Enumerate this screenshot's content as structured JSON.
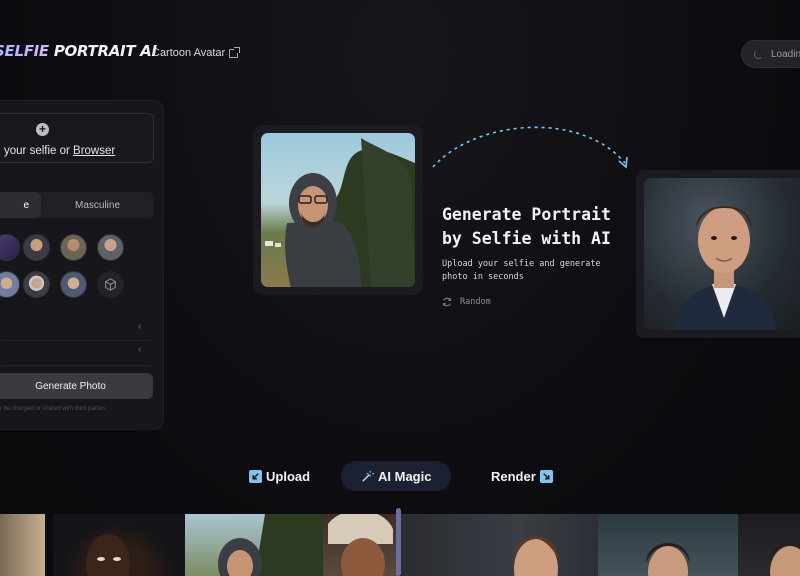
{
  "header": {
    "logo_part1": "SELFIE",
    "logo_part2": "PORTRAIT AI",
    "nav_link": "Cartoon Avatar",
    "loading_label": "Loadin"
  },
  "sidebar": {
    "upload_prefix": "your selfie or ",
    "upload_link": "Browser",
    "gender_options": [
      "e",
      "Masculine"
    ],
    "generate_button": "Generate Photo",
    "fine_print": "r be charged or shared with third parties"
  },
  "hero": {
    "title_line1": "Generate Portrait",
    "title_line2": "by Selfie with AI",
    "subtitle": "Upload your selfie and generate photo in seconds",
    "random_label": "Random"
  },
  "steps": [
    {
      "label": "Upload",
      "icon": "arrow-down-left-icon"
    },
    {
      "label": "AI Magic",
      "icon": "magic-wand-icon"
    },
    {
      "label": "Render",
      "icon": "arrow-down-right-icon"
    }
  ],
  "colors": {
    "accent_blue": "#7fc4ee",
    "logo_gradient_start": "#a9b6ff",
    "logo_gradient_end": "#d9b8ff",
    "step_active_bg": "#1b2130"
  }
}
